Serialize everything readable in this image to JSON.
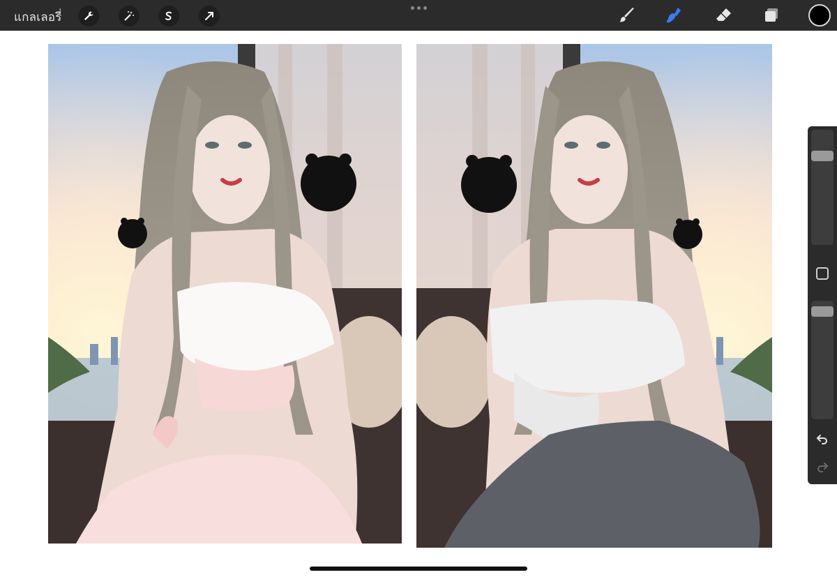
{
  "toolbar": {
    "gallery_label": "แกลเลอรี่",
    "left_tools": [
      "wrench-icon",
      "magic-wand-icon",
      "selection-icon",
      "transform-arrow-icon"
    ],
    "right_tools": [
      "brush-icon",
      "smudge-icon",
      "eraser-icon",
      "layers-icon"
    ],
    "active_tool": "smudge-icon",
    "active_color": "#000000",
    "accent_color": "#3b7cf0"
  },
  "sidebar": {
    "brush_size_level": 0.8,
    "opacity_level": 0.95,
    "icons": [
      "modify-square-icon",
      "undo-icon",
      "redo-icon"
    ]
  },
  "canvas": {
    "left_artwork_outfit": "pink",
    "right_artwork_outfit": "white-gray"
  }
}
